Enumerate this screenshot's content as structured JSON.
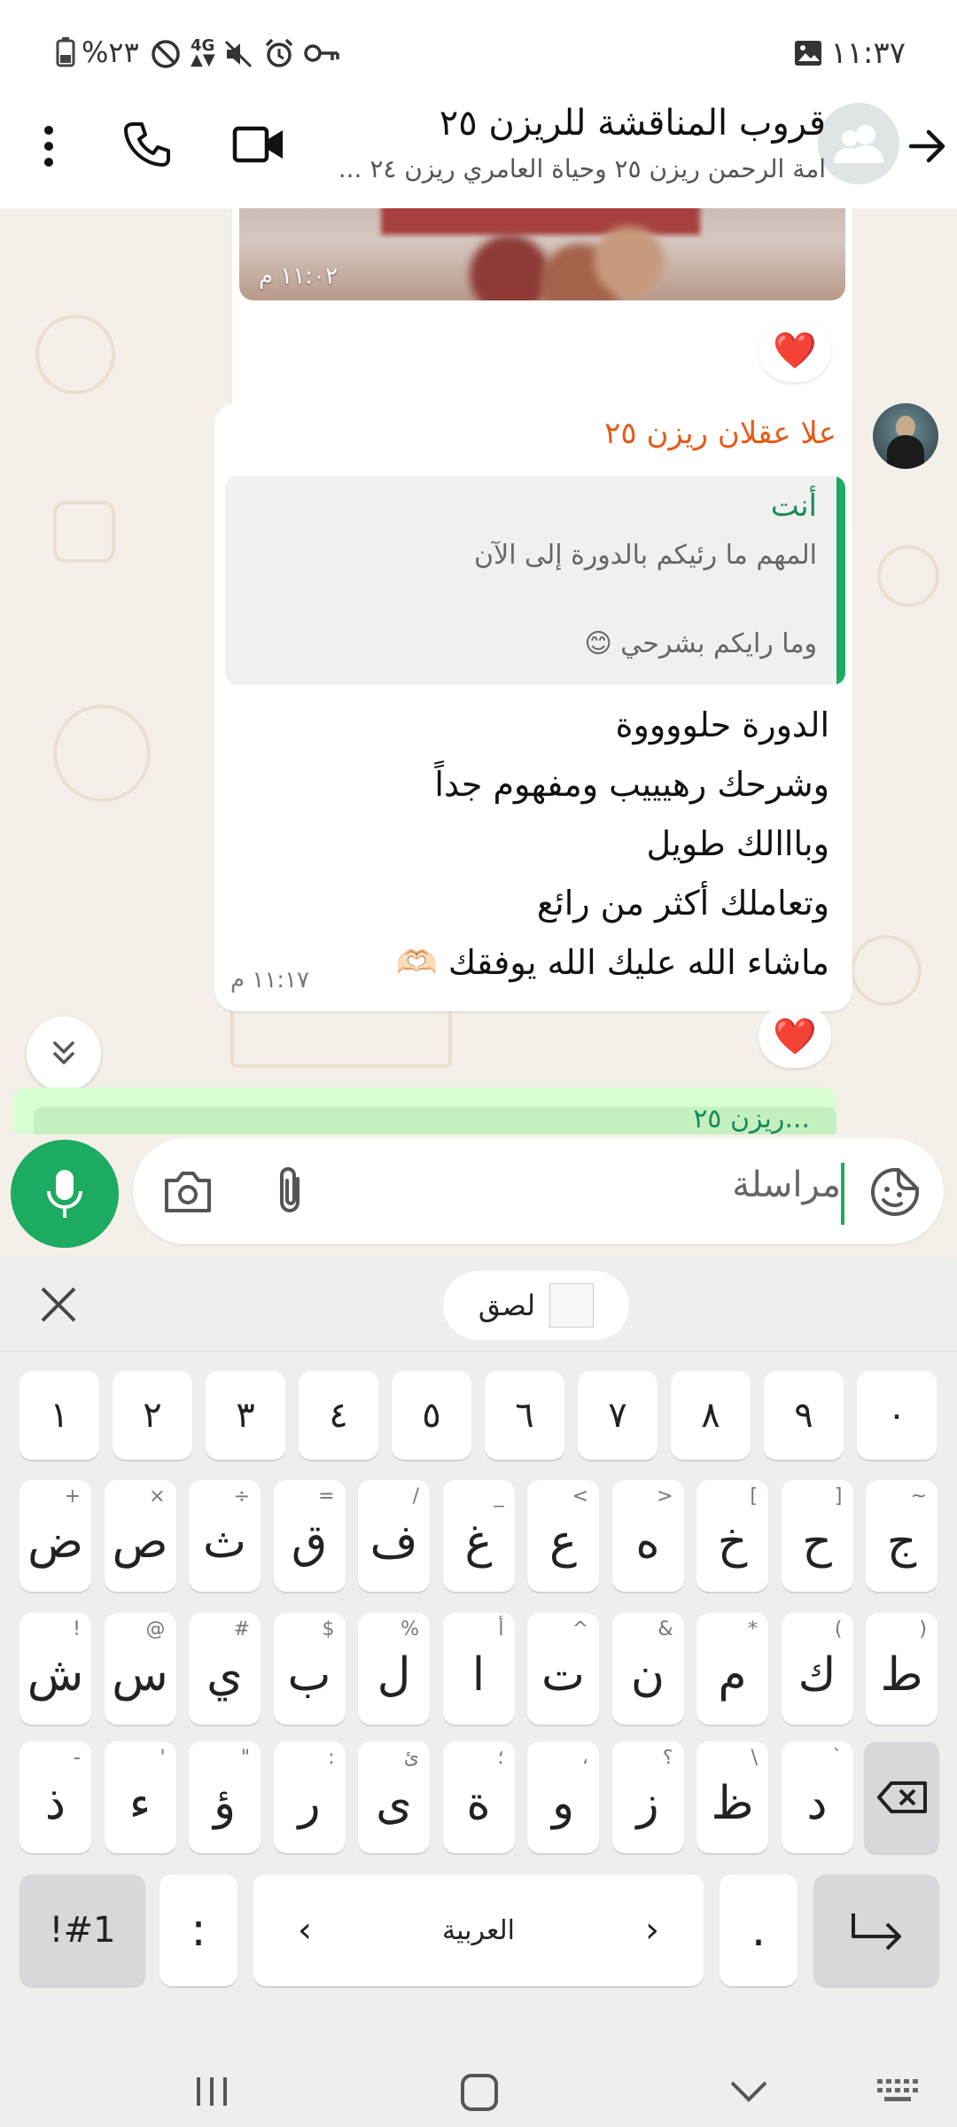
{
  "status_bar": {
    "time": "١١:٣٧",
    "battery_percent": "%٢٣",
    "network": "4G",
    "icons": [
      "battery-icon",
      "dnd-icon",
      "network-4g-icon",
      "mute-icon",
      "alarm-icon",
      "vpn-key-icon",
      "gallery-icon"
    ]
  },
  "header": {
    "title": "قروب المناقشة للريزن ٢٥",
    "subtitle": "امة الرحمن ريزن ٢٥ وحياة العامري ريزن ٢٤ ..."
  },
  "messages": [
    {
      "kind": "image",
      "time": "١١:٠٢ م",
      "reaction": "❤️"
    },
    {
      "kind": "text",
      "sender": "علا عقلان ريزن ٢٥",
      "quote": {
        "author": "أنت",
        "line1": "المهم ما رئيكم بالدورة إلى الآن",
        "line2": "وما رايكم بشرحي 😊"
      },
      "lines": [
        "الدورة حلووووة",
        "وشرحك رهيييب ومفهوم جداً",
        "وبااالك طويل",
        "وتعاملك أكثر من رائع",
        "ماشاء الله عليك الله يوفقك 🫶🏻"
      ],
      "time": "١١:١٧ م",
      "reaction": "❤️"
    },
    {
      "kind": "partial",
      "sender": "...ريزن ٢٥"
    }
  ],
  "composer": {
    "placeholder": "مراسلة"
  },
  "keyboard": {
    "clipboard_label": "لصق",
    "row_numbers": [
      "١",
      "٢",
      "٣",
      "٤",
      "٥",
      "٦",
      "٧",
      "٨",
      "٩",
      "٠"
    ],
    "row1": [
      {
        "k": "ض",
        "h": "+"
      },
      {
        "k": "ص",
        "h": "×"
      },
      {
        "k": "ث",
        "h": "÷"
      },
      {
        "k": "ق",
        "h": "="
      },
      {
        "k": "ف",
        "h": "/"
      },
      {
        "k": "غ",
        "h": "_"
      },
      {
        "k": "ع",
        "h": "<"
      },
      {
        "k": "ه",
        "h": ">"
      },
      {
        "k": "خ",
        "h": "["
      },
      {
        "k": "ح",
        "h": "]"
      },
      {
        "k": "ج",
        "h": "~"
      }
    ],
    "row2": [
      {
        "k": "ش",
        "h": "!"
      },
      {
        "k": "س",
        "h": "@"
      },
      {
        "k": "ي",
        "h": "#"
      },
      {
        "k": "ب",
        "h": "$"
      },
      {
        "k": "ل",
        "h": "%"
      },
      {
        "k": "ا",
        "h": "أ"
      },
      {
        "k": "ت",
        "h": "^"
      },
      {
        "k": "ن",
        "h": "&"
      },
      {
        "k": "م",
        "h": "*"
      },
      {
        "k": "ك",
        "h": "("
      },
      {
        "k": "ط",
        "h": ")"
      }
    ],
    "row3": [
      {
        "k": "ذ",
        "h": "-"
      },
      {
        "k": "ء",
        "h": "'"
      },
      {
        "k": "ؤ",
        "h": "\""
      },
      {
        "k": "ر",
        "h": ":"
      },
      {
        "k": "ى",
        "h": "ئ"
      },
      {
        "k": "ة",
        "h": "؛"
      },
      {
        "k": "و",
        "h": "،"
      },
      {
        "k": "ز",
        "h": "؟"
      },
      {
        "k": "ظ",
        "h": "\\"
      },
      {
        "k": "د",
        "h": "`"
      }
    ],
    "symbols_label": "!#1",
    "colon_label": ":",
    "space_label": "العربية",
    "period_label": "."
  }
}
